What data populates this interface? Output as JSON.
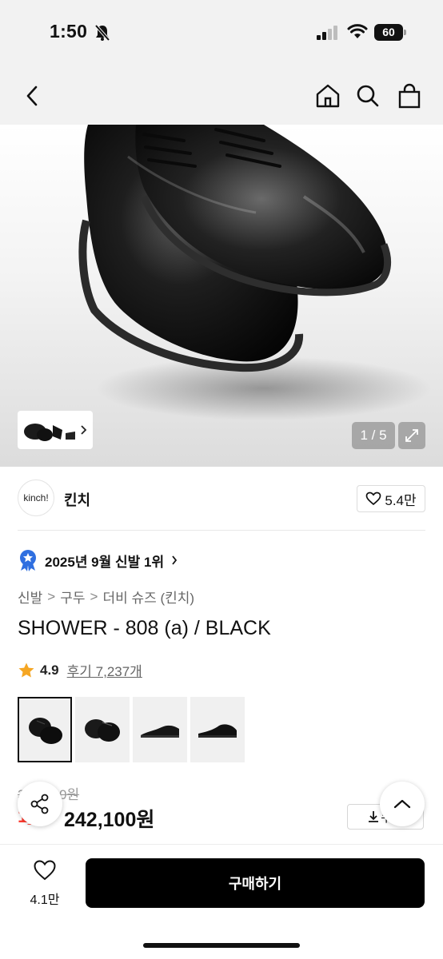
{
  "status_bar": {
    "time": "1:50",
    "battery": "60",
    "icons": [
      "bell-muted-icon",
      "signal-icon",
      "wifi-icon",
      "battery-icon"
    ]
  },
  "nav": {
    "icons": [
      "back-chevron-icon",
      "home-icon",
      "search-icon",
      "shopping-bag-icon"
    ]
  },
  "gallery": {
    "counter": "1 / 5",
    "icons": [
      "chevron-right-icon",
      "expand-icon"
    ]
  },
  "brand": {
    "logo_text": "kinch!",
    "name": "킨치",
    "likes": "5.4만"
  },
  "ranking": {
    "text": "2025년 9월 신발 1위"
  },
  "breadcrumb": {
    "items": [
      "신발",
      "구두",
      "더비 슈즈 (킨치)"
    ],
    "separator": ">"
  },
  "product": {
    "title": "SHOWER - 808 (a) / BLACK",
    "rating": "4.9",
    "reviews": "후기 7,237개"
  },
  "options": {
    "count": 4,
    "selected_index": 0
  },
  "price": {
    "original": "3__,_00원",
    "discount": "1_%",
    "current": "242,100원"
  },
  "coupon": {
    "label": "쿠폰"
  },
  "bottom": {
    "wish_count": "4.1만",
    "buy_label": "구매하기"
  },
  "colors": {
    "accent_star": "#f5a623",
    "discount": "#ff3b30",
    "badge_blue": "#2f6fe0",
    "buy_button": "#000000"
  }
}
